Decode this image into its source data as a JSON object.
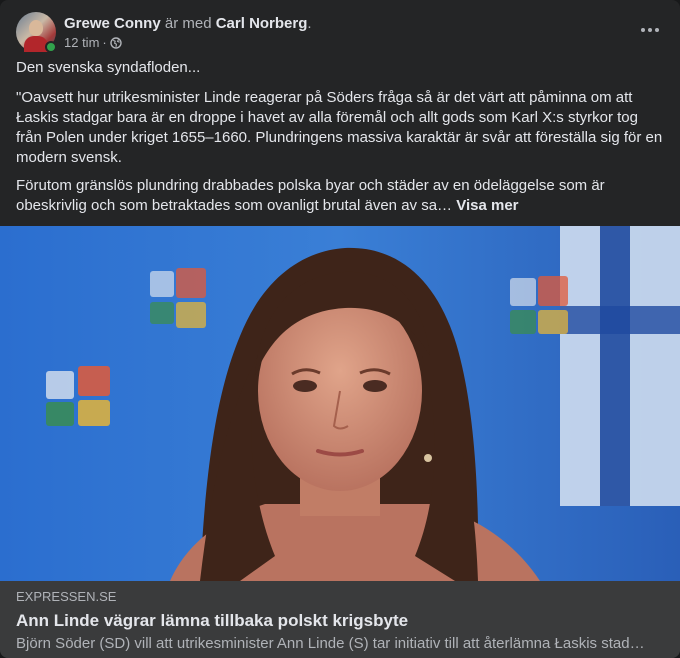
{
  "post": {
    "author": "Grewe Conny",
    "with_text": "är med",
    "tagged": "Carl Norberg",
    "period": ".",
    "time": "12 tim",
    "separator": "·",
    "privacy_icon": "globe-icon",
    "more_icon": "more-horizontal-icon",
    "paragraphs": [
      "Den svenska syndafloden...",
      "\"Oavsett hur utrikesminister Linde reagerar på Söders fråga så är det värt att påminna om att Łaskis stadgar bara är en droppe i havet av alla föremål och allt gods som Karl X:s styrkor tog från Polen under kriget 1655–1660. Plundringens massiva karaktär är svår att föreställa sig för en modern svensk.",
      "Förutom gränslös plundring drabbades polska byar och städer av en ödeläggelse som är obeskrivlig och som betraktades som ovanligt brutal även av sa…"
    ],
    "see_more": "Visa mer"
  },
  "link_preview": {
    "domain": "EXPRESSEN.SE",
    "title": "Ann Linde vägrar lämna tillbaka polskt krigsbyte",
    "description": "Björn Söder (SD) vill att utrikesminister Ann Linde (S) tar initiativ till att återlämna Łaskis stad…"
  },
  "colors": {
    "card_bg": "#242526",
    "link_bg": "#3a3b3c",
    "text_primary": "#e4e6eb",
    "text_secondary": "#b0b3b8",
    "online": "#31a24c"
  }
}
